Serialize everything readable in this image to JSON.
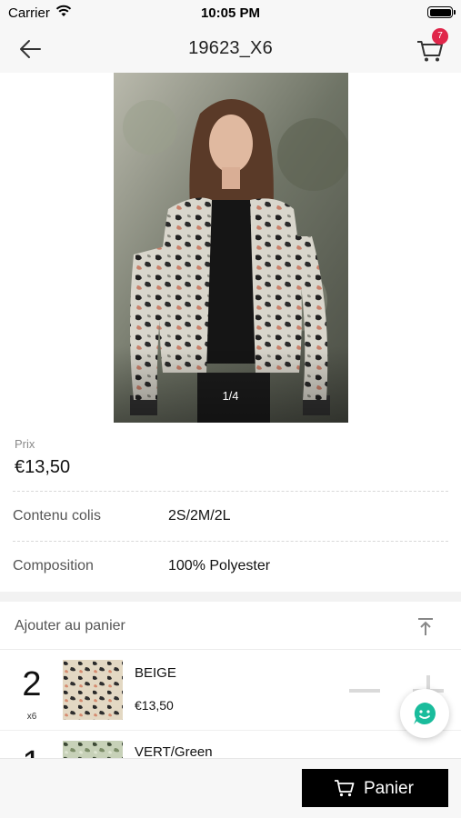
{
  "status_bar": {
    "carrier": "Carrier",
    "time": "10:05 PM"
  },
  "nav": {
    "title": "19623_X6",
    "cart_count": "7",
    "back_icon": "arrow-left-icon",
    "cart_icon": "cart-icon"
  },
  "product": {
    "image_pager": "1/4",
    "price_label": "Prix",
    "price": "€13,50",
    "details": [
      {
        "label": "Contenu colis",
        "value": "2S/2M/2L"
      },
      {
        "label": "Composition",
        "value": "100% Polyester"
      }
    ]
  },
  "add_to_cart": {
    "title": "Ajouter au panier",
    "variants": [
      {
        "quantity": "2",
        "multiplier": "x6",
        "color": "BEIGE",
        "price": "€13,50"
      },
      {
        "quantity": "1",
        "color": "VERT/Green"
      }
    ]
  },
  "bottom_bar": {
    "panier_label": "Panier"
  },
  "colors": {
    "badge": "#e0264a",
    "button": "#000000",
    "chat_accent": "#1abc9c"
  }
}
